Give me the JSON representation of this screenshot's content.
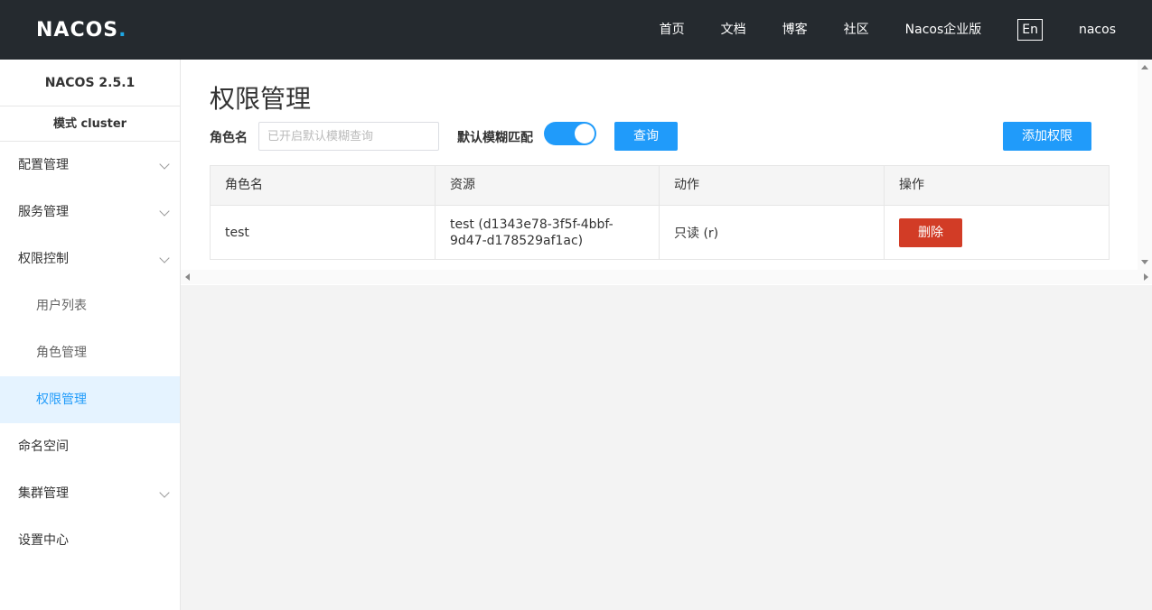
{
  "header": {
    "logo_text": "NACOS",
    "logo_dot": ".",
    "nav": [
      "首页",
      "文档",
      "博客",
      "社区",
      "Nacos企业版"
    ],
    "lang": "En",
    "user": "nacos"
  },
  "sidebar": {
    "version": "NACOS 2.5.1",
    "mode": "模式 cluster",
    "items": [
      {
        "label": "配置管理"
      },
      {
        "label": "服务管理"
      },
      {
        "label": "权限控制"
      },
      {
        "label": "用户列表"
      },
      {
        "label": "角色管理"
      },
      {
        "label": "权限管理"
      },
      {
        "label": "命名空间"
      },
      {
        "label": "集群管理"
      },
      {
        "label": "设置中心"
      }
    ]
  },
  "main": {
    "title": "权限管理",
    "role_label": "角色名",
    "search_placeholder": "已开启默认模糊查询",
    "fuzzy_label": "默认模糊匹配",
    "fuzzy_on": true,
    "query_button": "查询",
    "add_button": "添加权限",
    "table": {
      "headers": [
        "角色名",
        "资源",
        "动作",
        "操作"
      ],
      "rows": [
        {
          "role": "test",
          "resource": "test (d1343e78-3f5f-4bbf-9d47-d178529af1ac)",
          "action": "只读 (r)",
          "delete": "删除"
        }
      ]
    }
  },
  "colors": {
    "header_bg": "#252a2f",
    "primary": "#209bfa",
    "danger": "#d23c26",
    "active_bg": "#e5f3ff"
  }
}
